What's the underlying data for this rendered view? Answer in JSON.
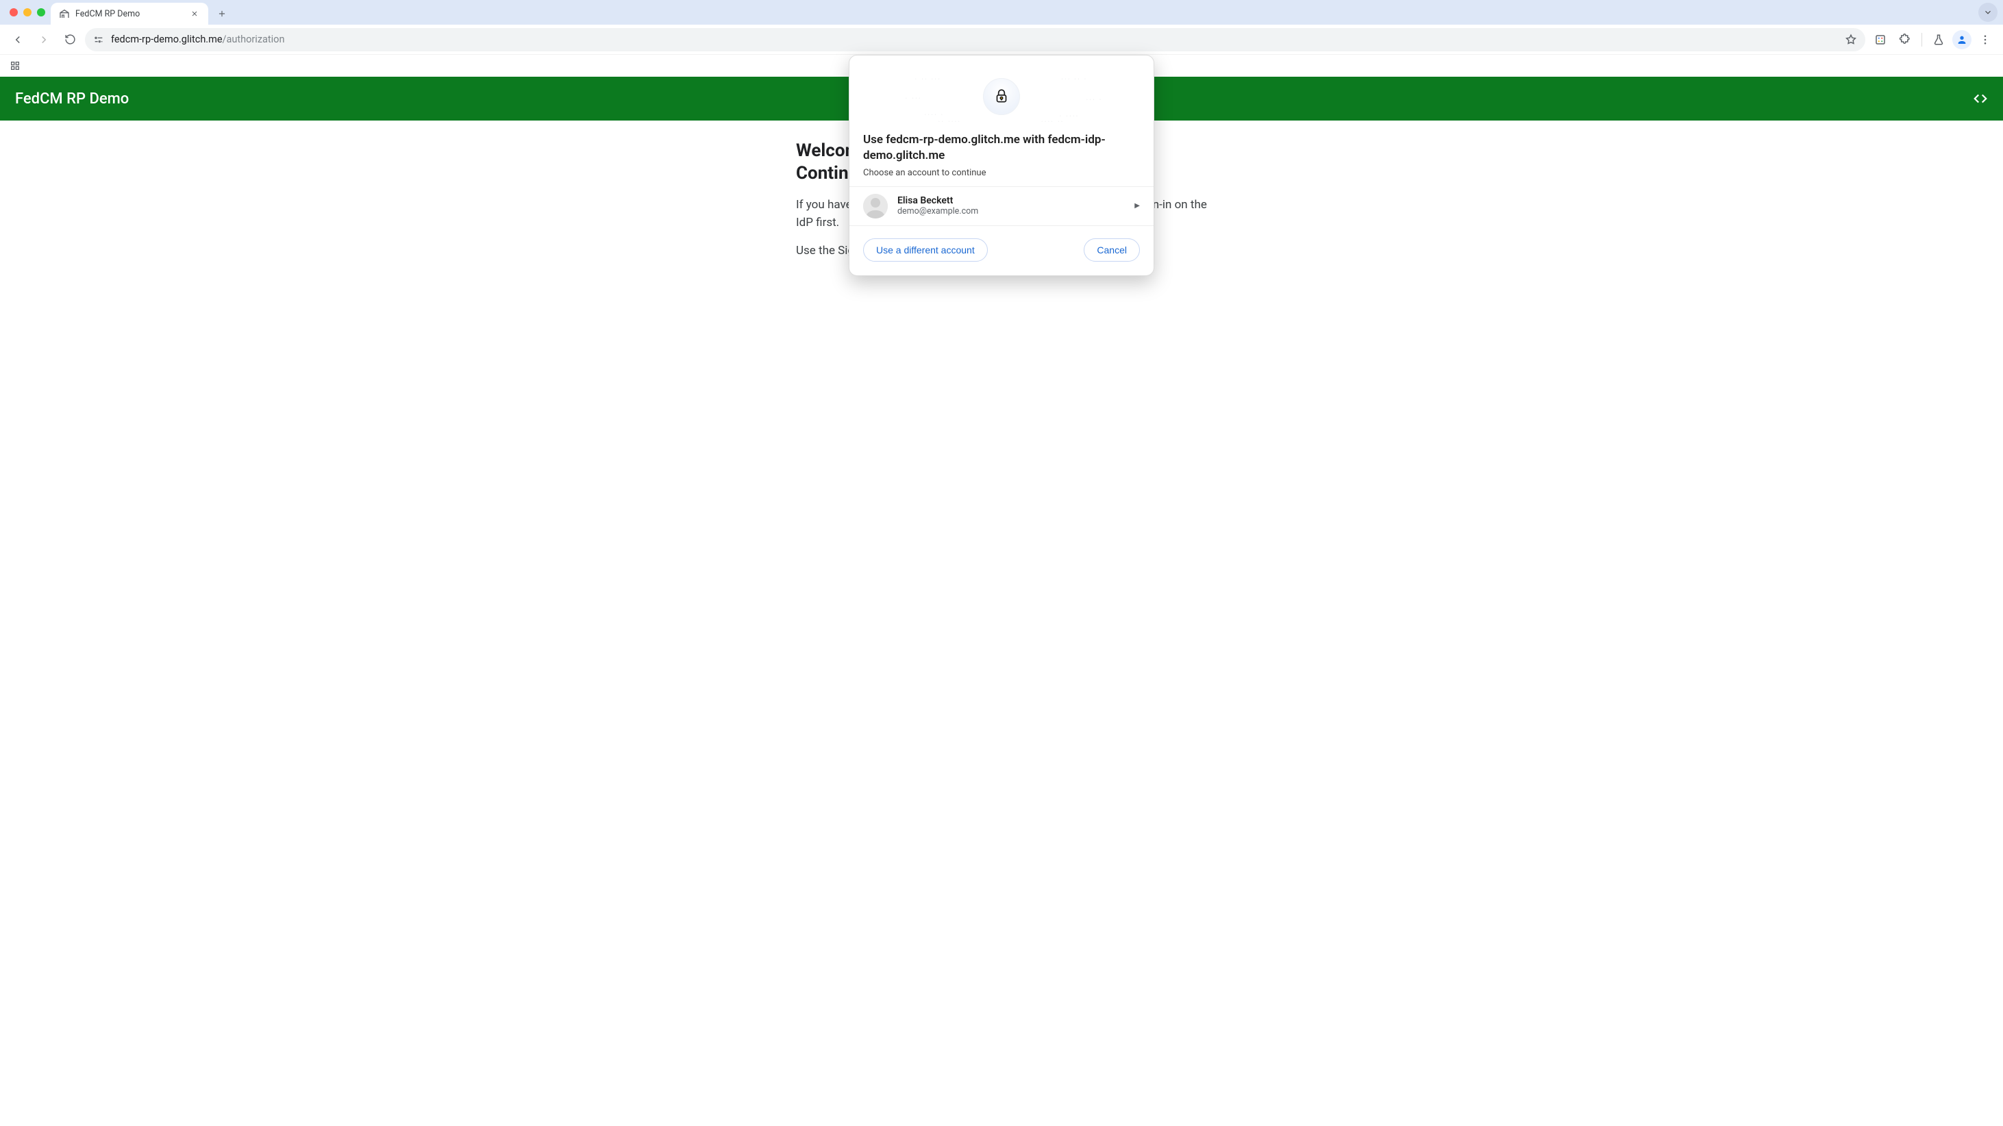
{
  "browser": {
    "tab_title": "FedCM RP Demo",
    "url_host": "fedcm-rp-demo.glitch.me",
    "url_path": "/authorization"
  },
  "page": {
    "banner_title": "FedCM RP Demo",
    "heading_line1": "Welcome to FedCM for RP",
    "heading_line2": "Continuation API Demo!",
    "para1": "If you haven't created an account or signed in to the IdP demo yet, sign-in on the IdP first.",
    "para2": "Use the Sign-in button to open the FedCM authorization dialog."
  },
  "dialog": {
    "title": "Use fedcm-rp-demo.glitch.me with fedcm-idp-demo.glitch.me",
    "subtitle": "Choose an account to continue",
    "accounts": [
      {
        "name": "Elisa Beckett",
        "email": "demo@example.com"
      }
    ],
    "different_label": "Use a different account",
    "cancel_label": "Cancel"
  }
}
